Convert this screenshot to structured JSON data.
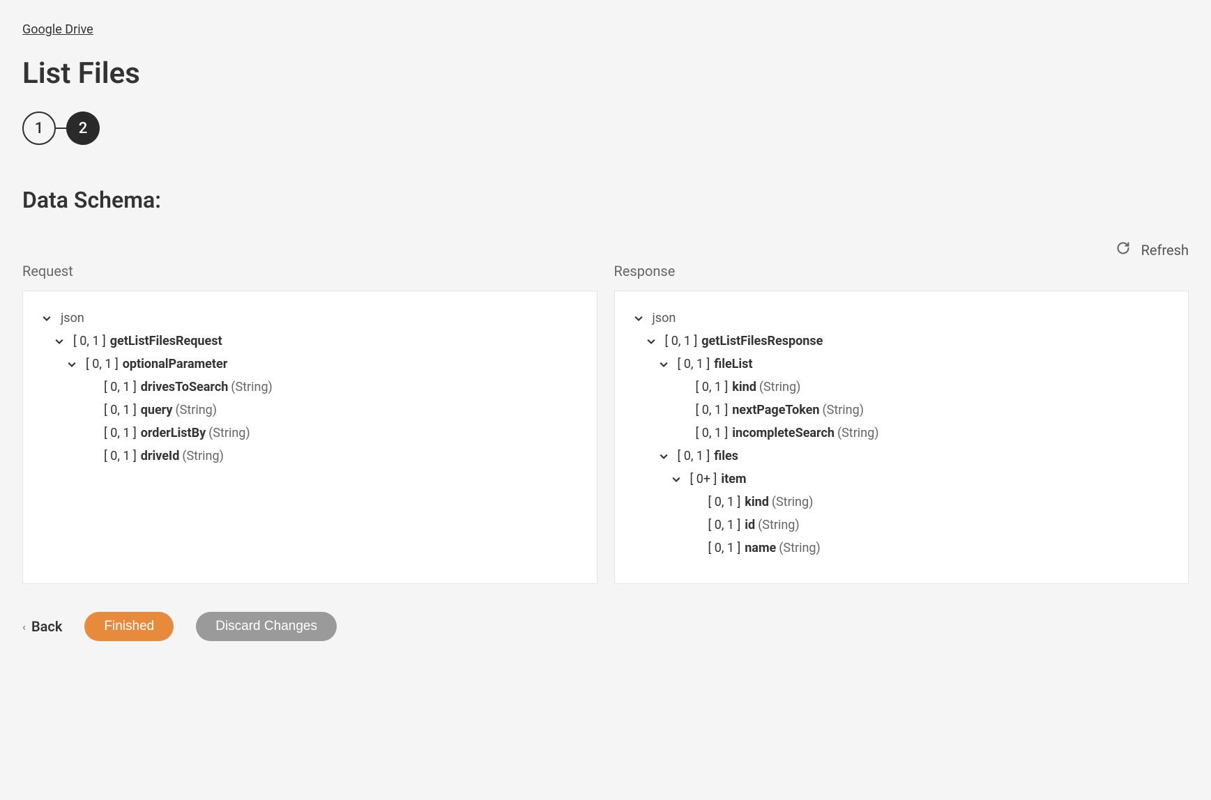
{
  "breadcrumb": "Google Drive",
  "title": "List Files",
  "stepper": {
    "step1": "1",
    "step2": "2"
  },
  "section_title": "Data Schema:",
  "refresh_label": "Refresh",
  "panels": {
    "request": {
      "label": "Request",
      "root": "json",
      "l1_card": "[ 0, 1 ]",
      "l1_name": "getListFilesRequest",
      "l2_card": "[ 0, 1 ]",
      "l2_name": "optionalParameter",
      "children": [
        {
          "card": "[ 0, 1 ]",
          "name": "drivesToSearch",
          "type": "(String)"
        },
        {
          "card": "[ 0, 1 ]",
          "name": "query",
          "type": "(String)"
        },
        {
          "card": "[ 0, 1 ]",
          "name": "orderListBy",
          "type": "(String)"
        },
        {
          "card": "[ 0, 1 ]",
          "name": "driveId",
          "type": "(String)"
        }
      ]
    },
    "response": {
      "label": "Response",
      "root": "json",
      "l1_card": "[ 0, 1 ]",
      "l1_name": "getListFilesResponse",
      "l2_card": "[ 0, 1 ]",
      "l2_name": "fileList",
      "children": [
        {
          "card": "[ 0, 1 ]",
          "name": "kind",
          "type": "(String)"
        },
        {
          "card": "[ 0, 1 ]",
          "name": "nextPageToken",
          "type": "(String)"
        },
        {
          "card": "[ 0, 1 ]",
          "name": "incompleteSearch",
          "type": "(String)"
        }
      ],
      "files_card": "[ 0, 1 ]",
      "files_name": "files",
      "item_card": "[ 0+ ]",
      "item_name": "item",
      "item_children": [
        {
          "card": "[ 0, 1 ]",
          "name": "kind",
          "type": "(String)"
        },
        {
          "card": "[ 0, 1 ]",
          "name": "id",
          "type": "(String)"
        },
        {
          "card": "[ 0, 1 ]",
          "name": "name",
          "type": "(String)"
        }
      ]
    }
  },
  "footer": {
    "back": "Back",
    "finished": "Finished",
    "discard": "Discard Changes"
  }
}
